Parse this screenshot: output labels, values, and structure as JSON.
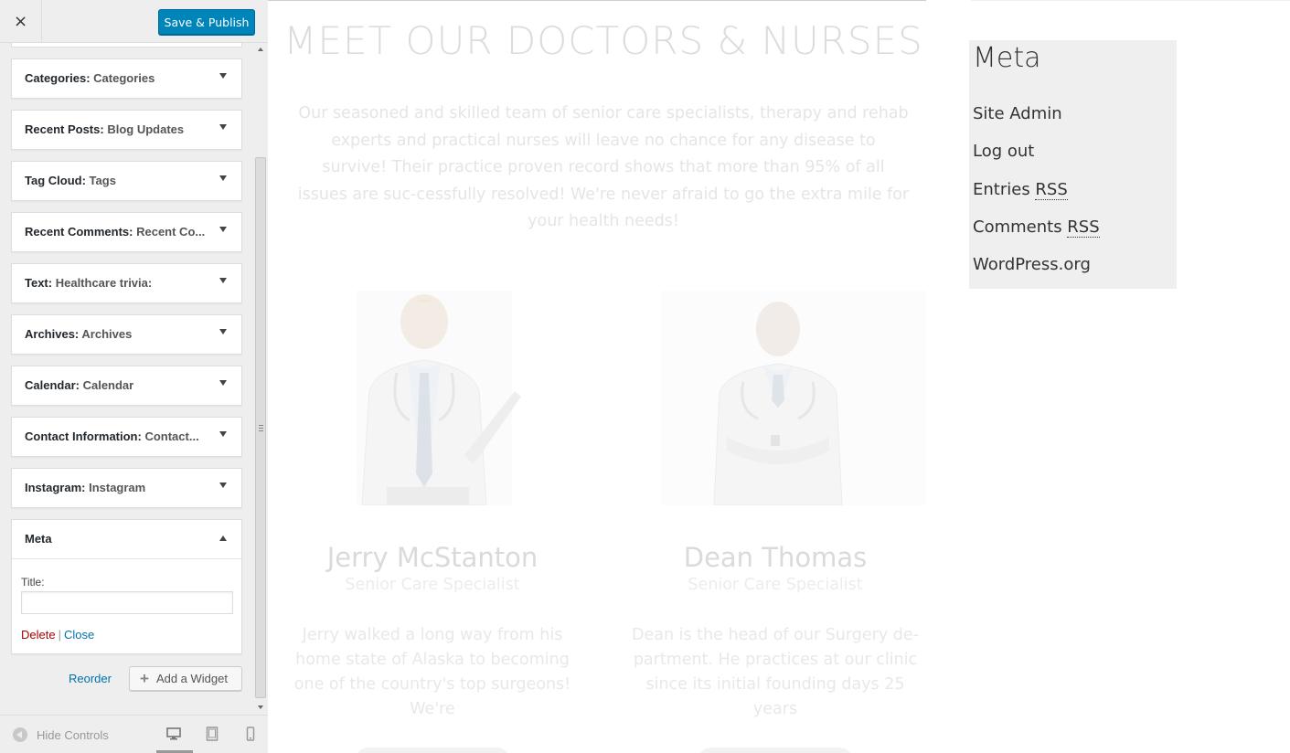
{
  "header": {
    "close_label": "×",
    "publish_label": "Save & Publish"
  },
  "widgets": [
    {
      "type": "Categories",
      "sep": ": ",
      "instance": "Categories"
    },
    {
      "type": "Recent Posts",
      "sep": ": ",
      "instance": "Blog Updates"
    },
    {
      "type": "Tag Cloud",
      "sep": ": ",
      "instance": "Tags"
    },
    {
      "type": "Recent Comments",
      "sep": ": ",
      "instance": "Recent Co..."
    },
    {
      "type": "Text",
      "sep": ": ",
      "instance": "Healthcare trivia:"
    },
    {
      "type": "Archives",
      "sep": ": ",
      "instance": "Archives"
    },
    {
      "type": "Calendar",
      "sep": ": ",
      "instance": "Calendar"
    },
    {
      "type": "Contact Information",
      "sep": ": ",
      "instance": "Contact..."
    },
    {
      "type": "Instagram",
      "sep": ": ",
      "instance": "Instagram"
    }
  ],
  "meta_widget": {
    "type": "Meta",
    "title_label": "Title:",
    "title_value": "",
    "delete_label": "Delete",
    "separator": "|",
    "close_label": "Close"
  },
  "actions": {
    "reorder_label": "Reorder",
    "add_widget_label": "Add a Widget"
  },
  "footer": {
    "hide_controls_label": "Hide Controls"
  },
  "preview": {
    "section_title": "MEET OUR DOCTORS & NURSES",
    "section_intro": "Our seasoned and skilled team of senior care specialists, therapy and rehab experts and practical nurses will leave no chance for any disease to survive! Their practice proven record shows that more than 95% of all issues are suc-cessfully resolved! We're never afraid to go the extra mile for your health needs!",
    "doctors": [
      {
        "name": "Jerry McStanton",
        "role": "Senior Care Specialist",
        "bio": "Jerry walked a long way from his home state of Alaska to becoming one of the country's top surgeons! We're"
      },
      {
        "name": "Dean Thomas",
        "role": "Senior Care Specialist",
        "bio": "Dean is the head of our Surgery de-partment. He practices at our clinic since its initial founding days 25 years"
      }
    ],
    "meta_sidebar": {
      "title": "Meta",
      "site_admin": "Site Admin",
      "log_out": "Log out",
      "entries": "Entries ",
      "comments": "Comments ",
      "rss": "RSS",
      "wordpress": "WordPress.org"
    }
  },
  "colors": {
    "publish_bg": "#0085ba",
    "link_blue": "#0073aa",
    "delete_red": "#aa0000"
  }
}
